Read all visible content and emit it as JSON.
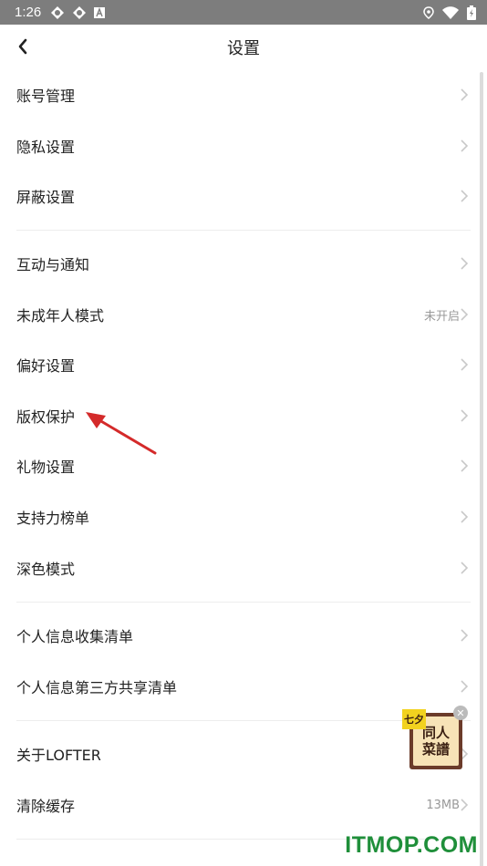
{
  "status_bar": {
    "time": "1:26",
    "left_icons": [
      "lofter-icon",
      "lofter-icon",
      "a-icon"
    ],
    "right_icons": [
      "location-icon",
      "wifi-icon",
      "battery-icon"
    ]
  },
  "header": {
    "title": "设置",
    "back_icon": "chevron-left-icon"
  },
  "groups": [
    [
      {
        "label": "账号管理",
        "value": ""
      },
      {
        "label": "隐私设置",
        "value": ""
      },
      {
        "label": "屏蔽设置",
        "value": ""
      }
    ],
    [
      {
        "label": "互动与通知",
        "value": ""
      },
      {
        "label": "未成年人模式",
        "value": "未开启"
      },
      {
        "label": "偏好设置",
        "value": ""
      },
      {
        "label": "版权保护",
        "value": ""
      },
      {
        "label": "礼物设置",
        "value": ""
      },
      {
        "label": "支持力榜单",
        "value": ""
      },
      {
        "label": "深色模式",
        "value": ""
      }
    ],
    [
      {
        "label": "个人信息收集清单",
        "value": ""
      },
      {
        "label": "个人信息第三方共享清单",
        "value": ""
      }
    ],
    [
      {
        "label": "关于LOFTER",
        "value": ""
      },
      {
        "label": "清除缓存",
        "value": "13MB"
      }
    ]
  ],
  "sticker": {
    "tag": "七夕",
    "line1": "同人",
    "line2": "菜譜"
  },
  "watermark": "ITMOP.COM",
  "colors": {
    "statusbar": "#7d7d7d",
    "annotation_arrow": "#d42a2a",
    "watermark": "#1f8f3a"
  }
}
